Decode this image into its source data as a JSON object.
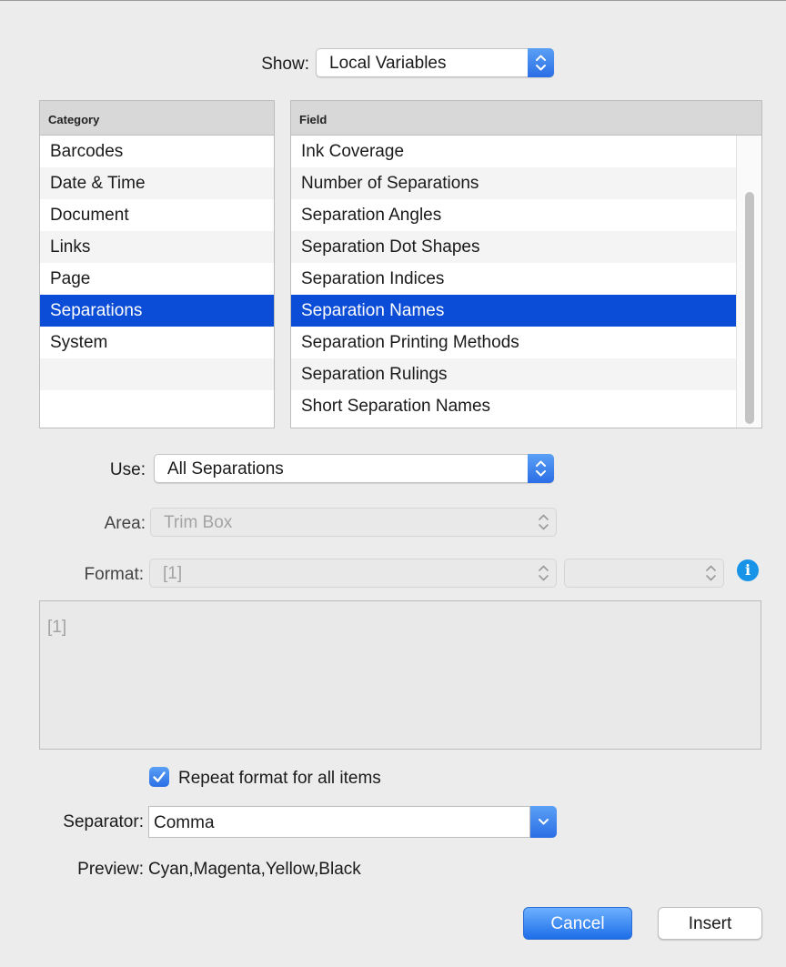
{
  "show": {
    "label": "Show:",
    "value": "Local Variables"
  },
  "category": {
    "header": "Category",
    "items": [
      "Barcodes",
      "Date & Time",
      "Document",
      "Links",
      "Page",
      "Separations",
      "System"
    ],
    "selected": "Separations"
  },
  "field": {
    "header": "Field",
    "items": [
      "Ink Coverage",
      "Number of Separations",
      "Separation Angles",
      "Separation Dot Shapes",
      "Separation Indices",
      "Separation Names",
      "Separation Printing Methods",
      "Separation Rulings",
      "Short Separation Names"
    ],
    "selected": "Separation Names"
  },
  "use": {
    "label": "Use:",
    "value": "All Separations"
  },
  "area": {
    "label": "Area:",
    "value": "Trim Box"
  },
  "format": {
    "label": "Format:",
    "value": "[1]",
    "secondary_value": ""
  },
  "format_text": "[1]",
  "repeat": {
    "label": "Repeat format for all items",
    "checked": true
  },
  "separator": {
    "label": "Separator:",
    "value": "Comma"
  },
  "preview": {
    "label": "Preview:",
    "value": "Cyan,Magenta,Yellow,Black"
  },
  "buttons": {
    "cancel": "Cancel",
    "insert": "Insert"
  },
  "colors": {
    "accent": "#2b6ee6",
    "selection": "#0b4dd7",
    "info": "#1794e8"
  },
  "icons": {
    "popup": "up-down-chevrons-icon",
    "combo": "chevron-down-icon",
    "info": "info-icon",
    "check": "checkmark-icon"
  }
}
